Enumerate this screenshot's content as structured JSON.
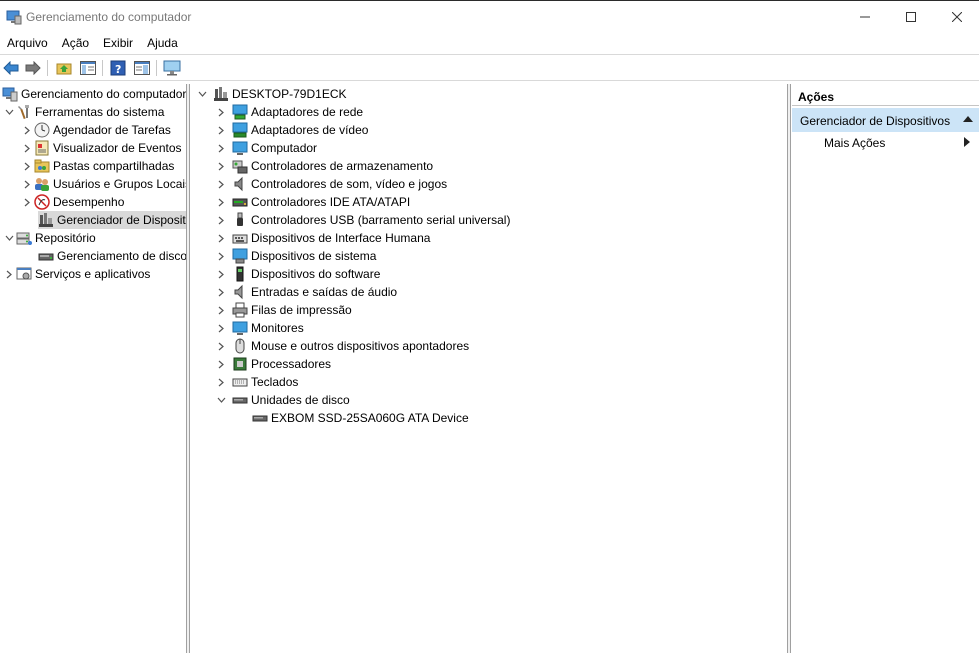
{
  "window": {
    "title": "Gerenciamento do computador"
  },
  "menu": [
    "Arquivo",
    "Ação",
    "Exibir",
    "Ajuda"
  ],
  "toolbar": {
    "icons": [
      "back-arrow-icon",
      "forward-arrow-icon",
      "up-folder-icon",
      "show-hide-tree-icon",
      "help-icon",
      "properties-icon",
      "monitor-icon"
    ]
  },
  "left_tree": {
    "root": "Gerenciamento do computador (Local)",
    "system_tools": "Ferramentas do sistema",
    "task_scheduler": "Agendador de Tarefas",
    "event_viewer": "Visualizador de Eventos",
    "shared_folders": "Pastas compartilhadas",
    "local_users": "Usuários e Grupos Locais",
    "performance": "Desempenho",
    "device_manager": "Gerenciador de Dispositivos",
    "storage": "Repositório",
    "disk_management": "Gerenciamento de disco",
    "services": "Serviços e aplicativos"
  },
  "device_tree": {
    "computer_name": "DESKTOP-79D1ECK",
    "categories": [
      "Adaptadores de rede",
      "Adaptadores de vídeo",
      "Computador",
      "Controladores de armazenamento",
      "Controladores de som, vídeo e jogos",
      "Controladores IDE ATA/ATAPI",
      "Controladores USB (barramento serial universal)",
      "Dispositivos de Interface Humana",
      "Dispositivos de sistema",
      "Dispositivos do software",
      "Entradas e saídas de áudio",
      "Filas de impressão",
      "Monitores",
      "Mouse e outros dispositivos apontadores",
      "Processadores",
      "Teclados",
      "Unidades de disco"
    ],
    "disk_device": "EXBOM SSD-25SA060G ATA Device"
  },
  "actions": {
    "header": "Ações",
    "section": "Gerenciador de Dispositivos",
    "more": "Mais Ações"
  },
  "colors": {
    "selection": "#d9d9d9",
    "actions_highlight": "#cce4f7"
  }
}
